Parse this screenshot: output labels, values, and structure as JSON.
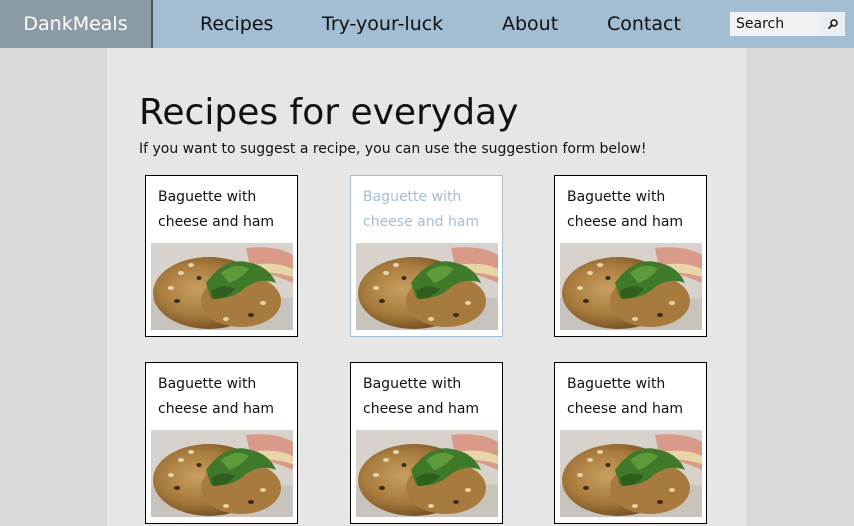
{
  "nav": {
    "brand": "DankMeals",
    "links": [
      "Recipes",
      "Try-your-luck",
      "About",
      "Contact"
    ],
    "search_placeholder": "Search",
    "search_icon": "search-icon"
  },
  "main": {
    "title": "Recipes for everyday",
    "subtitle": "If you want to suggest a recipe, you can use the suggestion form below!"
  },
  "recipes": [
    {
      "title": "Baguette with cheese and ham",
      "state": "default"
    },
    {
      "title": "Baguette with cheese and ham",
      "state": "hover"
    },
    {
      "title": "Baguette with cheese and ham",
      "state": "default"
    },
    {
      "title": "Baguette with cheese and ham",
      "state": "default"
    },
    {
      "title": "Baguette with cheese and ham",
      "state": "default"
    },
    {
      "title": "Baguette with cheese and ham",
      "state": "default"
    }
  ],
  "colors": {
    "navbar": "#a3bdd2",
    "brand_bg": "#8b9ba5",
    "content_bg": "#e6e6e6",
    "page_bg": "#d9d9d9",
    "hover_accent": "#a3bdd2"
  }
}
